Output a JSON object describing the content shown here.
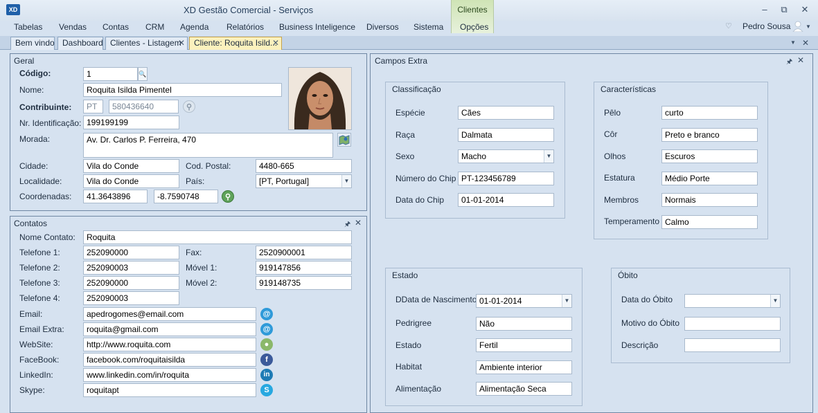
{
  "app": {
    "logo": "XD",
    "title": "XD Gestão Comercial - Serviços",
    "context_tab": "Clientes",
    "user": "Pedro Sousa"
  },
  "colors": {
    "accent": "#1f5fa8",
    "context_green": "#cfe4b5",
    "active_tab": "#fbf1bd"
  },
  "menu": [
    "Tabelas",
    "Vendas",
    "Contas",
    "CRM",
    "Agenda",
    "Relatórios",
    "Business Inteligence",
    "Diversos",
    "Sistema",
    "Opções"
  ],
  "tabs": [
    "Bem vindo",
    "Dashboard",
    "Clientes - Listagem",
    "Cliente: Roquita Isild..."
  ],
  "geral": {
    "title": "Geral",
    "codigo_label": "Código:",
    "codigo": "1",
    "nome_label": "Nome:",
    "nome": "Roquita Isilda Pimentel",
    "contribuinte_label": "Contribuinte:",
    "contribuinte_pais": "PT",
    "contribuinte": "580436640",
    "nrid_label": "Nr. Identificação:",
    "nrid": "199199199",
    "morada_label": "Morada:",
    "morada": "Av. Dr. Carlos P. Ferreira, 470",
    "cidade_label": "Cidade:",
    "cidade": "Vila do Conde",
    "codpostal_label": "Cod. Postal:",
    "codpostal": "4480-665",
    "localidade_label": "Localidade:",
    "localidade": "Vila do Conde",
    "pais_label": "País:",
    "pais": "[PT, Portugal]",
    "coord_label": "Coordenadas:",
    "lat": "41.3643896",
    "lon": "-8.7590748"
  },
  "contactos": {
    "title": "Contatos",
    "nome_label": "Nome Contato:",
    "nome": "Roquita",
    "tel1_label": "Telefone 1:",
    "tel1": "252090000",
    "fax_label": "Fax:",
    "fax": "2520900001",
    "tel2_label": "Telefone 2:",
    "tel2": "252090003",
    "movel1_label": "Móvel 1:",
    "movel1": "919147856",
    "tel3_label": "Telefone 3:",
    "tel3": "252090000",
    "movel2_label": "Móvel 2:",
    "movel2": "919148735",
    "tel4_label": "Telefone 4:",
    "tel4": "252090003",
    "email_label": "Email:",
    "email": "apedrogomes@email.com",
    "emailextra_label": "Email Extra:",
    "emailextra": "roquita@gmail.com",
    "website_label": "WebSite:",
    "website": "http://www.roquita.com",
    "facebook_label": "FaceBook:",
    "facebook": "facebook.com/roquitaisilda",
    "linkedin_label": "LinkedIn:",
    "linkedin": "www.linkedin.com/in/roquita",
    "skype_label": "Skype:",
    "skype": "roquitapt"
  },
  "extra": {
    "title": "Campos Extra",
    "classificacao": {
      "title": "Classificação",
      "especie_label": "Espécie",
      "especie": "Cães",
      "raca_label": "Raça",
      "raca": "Dalmata",
      "sexo_label": "Sexo",
      "sexo": "Macho",
      "chip_label": "Número do Chip",
      "chip": "PT-123456789",
      "datachip_label": "Data do Chip",
      "datachip": "01-01-2014"
    },
    "caracteristicas": {
      "title": "Características",
      "pelo_label": "Pêlo",
      "pelo": "curto",
      "cor_label": "Côr",
      "cor": "Preto e branco",
      "olhos_label": "Olhos",
      "olhos": "Escuros",
      "estatura_label": "Estatura",
      "estatura": "Médio Porte",
      "membros_label": "Membros",
      "membros": "Normais",
      "temperamento_label": "Temperamento",
      "temperamento": "Calmo"
    },
    "estado": {
      "title": "Estado",
      "nasc_label": "DData de Nascimento",
      "nasc": "01-01-2014",
      "pedigree_label": "Pedrigree",
      "pedigree": "Não",
      "estado_label": "Estado",
      "estado": "Fertil",
      "habitat_label": "Habitat",
      "habitat": "Ambiente interior",
      "alimentacao_label": "Alimentação",
      "alimentacao": "Alimentação Seca"
    },
    "obito": {
      "title": "Óbito",
      "data_label": "Data do Óbito",
      "data": "",
      "motivo_label": "Motivo do Óbito",
      "motivo": "",
      "descricao_label": "Descrição",
      "descricao": ""
    }
  }
}
